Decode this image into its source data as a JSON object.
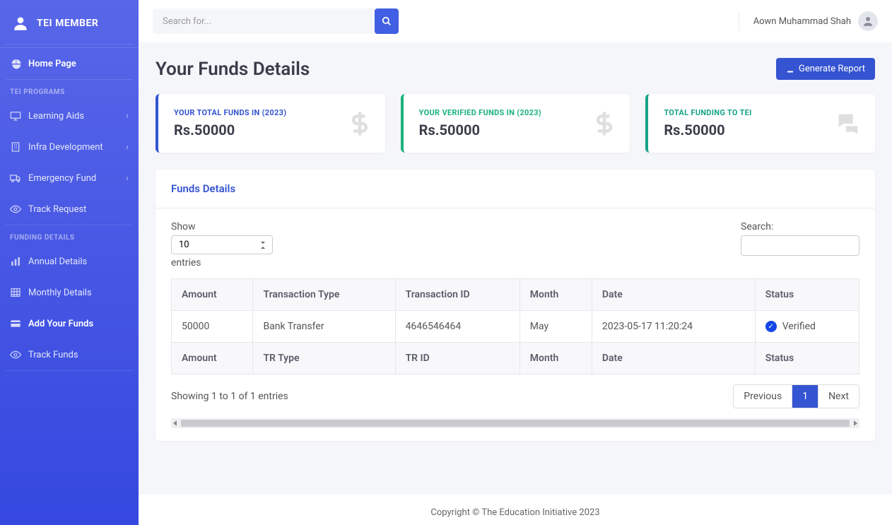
{
  "brand": "TEI MEMBER",
  "search": {
    "placeholder": "Search for..."
  },
  "user": {
    "name": "Aown Muhammad Shah"
  },
  "sidebar": {
    "home": "Home Page",
    "section_programs": "TEI PROGRAMS",
    "items_programs": [
      {
        "label": "Learning Aids",
        "expandable": true
      },
      {
        "label": "Infra Development",
        "expandable": true
      },
      {
        "label": "Emergency Fund",
        "expandable": true
      },
      {
        "label": "Track Request",
        "expandable": false
      }
    ],
    "section_funding": "FUNDING DETAILS",
    "items_funding": [
      {
        "label": "Annual Details"
      },
      {
        "label": "Monthly Details"
      },
      {
        "label": "Add Your Funds"
      },
      {
        "label": "Track Funds"
      }
    ]
  },
  "page": {
    "title": "Your Funds Details",
    "generate_btn": "Generate Report"
  },
  "cards": [
    {
      "label": "YOUR TOTAL FUNDS IN (2023)",
      "value": "Rs.50000"
    },
    {
      "label": "YOUR VERIFIED FUNDS IN (2023)",
      "value": "Rs.50000"
    },
    {
      "label": "TOTAL FUNDING TO TEI",
      "value": "Rs.50000"
    }
  ],
  "panel": {
    "title": "Funds Details",
    "show_label": "Show",
    "show_value": "10",
    "entries_label": "entries",
    "search_label": "Search:",
    "columns": [
      "Amount",
      "Transaction Type",
      "Transaction ID",
      "Month",
      "Date",
      "Status"
    ],
    "rows": [
      {
        "amount": "50000",
        "type": "Bank Transfer",
        "txid": "4646546464",
        "month": "May",
        "date": "2023-05-17 11:20:24",
        "status": "Verified"
      }
    ],
    "footer_columns": [
      "Amount",
      "TR Type",
      "TR ID",
      "Month",
      "Date",
      "Status"
    ],
    "info": "Showing 1 to 1 of 1 entries",
    "prev": "Previous",
    "page1": "1",
    "next": "Next"
  },
  "footer": "Copyright © The Education Initiative 2023"
}
